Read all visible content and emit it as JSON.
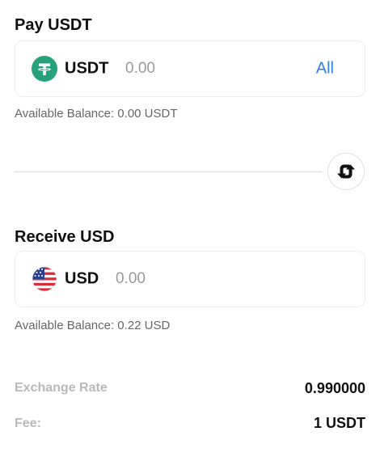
{
  "pay": {
    "title": "Pay USDT",
    "coin": "USDT",
    "amount_placeholder": "0.00",
    "all_label": "All",
    "balance": "Available Balance: 0.00 USDT",
    "icon": "tether-icon",
    "icon_color": "#26a17b"
  },
  "swap": {
    "icon": "swap-arrows-icon"
  },
  "receive": {
    "title": "Receive USD",
    "coin": "USD",
    "amount_placeholder": "0.00",
    "balance": "Available Balance: 0.22 USD",
    "icon": "us-flag-icon"
  },
  "details": {
    "exchange_rate_label": "Exchange Rate",
    "exchange_rate_value": "0.990000",
    "fee_label": "Fee:",
    "fee_value": "1 USDT"
  },
  "colors": {
    "accent": "#2f80ed",
    "muted_label": "#b9b9b9"
  }
}
